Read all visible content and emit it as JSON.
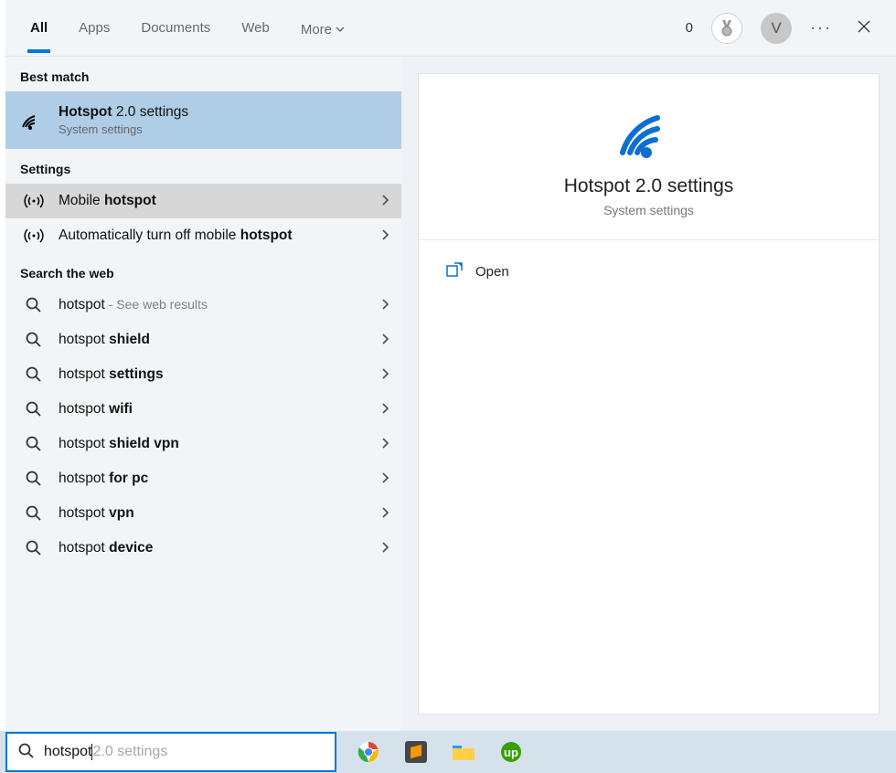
{
  "titlebar": {
    "tabs": [
      "All",
      "Apps",
      "Documents",
      "Web",
      "More"
    ],
    "points": "0",
    "avatar": "V"
  },
  "sections": {
    "best_match_label": "Best match",
    "settings_label": "Settings",
    "web_label": "Search the web"
  },
  "best_match": {
    "prefix": "Hotspot",
    "suffix": " 2.0 settings",
    "sub": "System settings"
  },
  "settings_results": [
    {
      "prefix": "Mobile ",
      "bold": "hotspot"
    },
    {
      "prefix": "Automatically turn off mobile ",
      "bold": "hotspot"
    }
  ],
  "web_results": [
    {
      "prefix": "hotspot",
      "bold": "",
      "suffix": " - See web results"
    },
    {
      "prefix": "hotspot ",
      "bold": "shield"
    },
    {
      "prefix": "hotspot ",
      "bold": "settings"
    },
    {
      "prefix": "hotspot ",
      "bold": "wifi"
    },
    {
      "prefix": "hotspot ",
      "bold": "shield vpn"
    },
    {
      "prefix": "hotspot ",
      "bold": "for pc"
    },
    {
      "prefix": "hotspot ",
      "bold": "vpn"
    },
    {
      "prefix": "hotspot ",
      "bold": "device"
    }
  ],
  "preview": {
    "title": "Hotspot 2.0 settings",
    "sub": "System settings",
    "open": "Open"
  },
  "search": {
    "typed": "hotspot",
    "ghost": " 2.0 settings"
  }
}
